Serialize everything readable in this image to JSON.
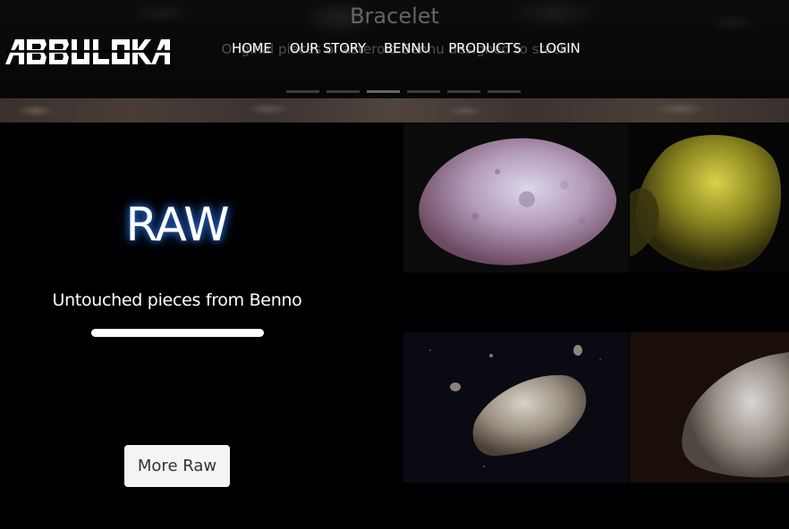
{
  "hero": {
    "slide_title": "Bracelet",
    "slide_subtitle": "Original pieces of asteroid Bennu designed to stack",
    "slide_count": 6,
    "active_slide": 3
  },
  "brand": {
    "logo_text": "ABBULOKA"
  },
  "nav": {
    "items": [
      {
        "label": "HOME"
      },
      {
        "label": "OUR STORY"
      },
      {
        "label": "BENNU"
      },
      {
        "label": "PRODUCTS"
      },
      {
        "label": "LOGIN"
      }
    ]
  },
  "raw": {
    "title": "RAW",
    "subtitle": "Untouched pieces from Benno",
    "button_label": "More Raw",
    "glow_color": "#2a6fd6"
  },
  "gallery": {
    "tiles": [
      {
        "icon": "asteroid-pink-image"
      },
      {
        "icon": "asteroid-yellow-image"
      },
      {
        "icon": "asteroid-space-image"
      },
      {
        "icon": "asteroid-closeup-image"
      }
    ]
  }
}
